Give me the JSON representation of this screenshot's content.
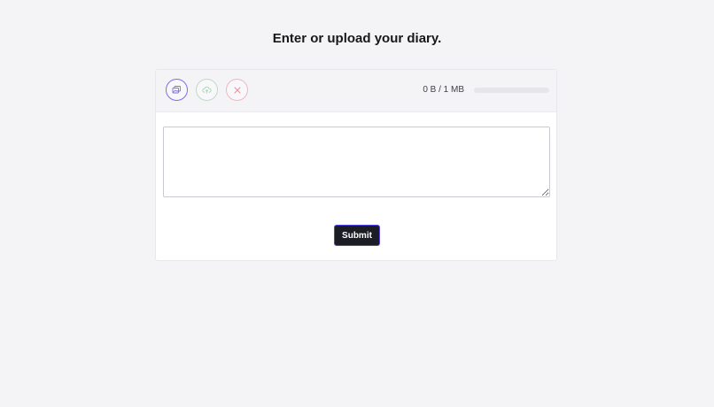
{
  "heading": "Enter or upload your diary.",
  "toolbar": {
    "choose_icon": "images-icon",
    "upload_icon": "cloud-upload-icon",
    "cancel_icon": "close-icon",
    "size_text": "0 B / 1 MB",
    "progress": 0
  },
  "diary": {
    "value": "",
    "placeholder": ""
  },
  "submit_label": "Submit",
  "colors": {
    "accent": "#7c6ee6",
    "success": "#b9dcc3",
    "danger": "#f1b7bf",
    "button_bg": "#1c1c24"
  }
}
